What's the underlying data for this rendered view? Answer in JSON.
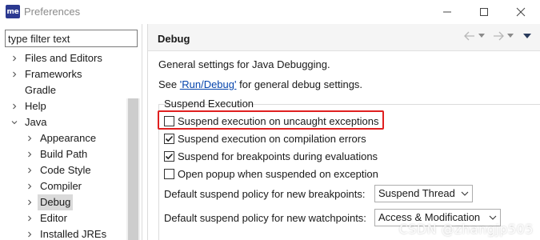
{
  "window": {
    "app_icon_text": "me",
    "title": "Preferences"
  },
  "sidebar": {
    "filter_placeholder": "type filter text",
    "items": [
      {
        "label": "Files and Editors",
        "level": 1,
        "expander": "collapsed"
      },
      {
        "label": "Frameworks",
        "level": 1,
        "expander": "collapsed"
      },
      {
        "label": "Gradle",
        "level": 1,
        "expander": "none"
      },
      {
        "label": "Help",
        "level": 1,
        "expander": "collapsed"
      },
      {
        "label": "Java",
        "level": 1,
        "expander": "expanded"
      },
      {
        "label": "Appearance",
        "level": 2,
        "expander": "collapsed"
      },
      {
        "label": "Build Path",
        "level": 2,
        "expander": "collapsed"
      },
      {
        "label": "Code Style",
        "level": 2,
        "expander": "collapsed"
      },
      {
        "label": "Compiler",
        "level": 2,
        "expander": "collapsed"
      },
      {
        "label": "Debug",
        "level": 2,
        "expander": "collapsed",
        "selected": true
      },
      {
        "label": "Editor",
        "level": 2,
        "expander": "collapsed"
      },
      {
        "label": "Installed JREs",
        "level": 2,
        "expander": "collapsed"
      }
    ]
  },
  "page": {
    "title": "Debug",
    "nav_icons": [
      "back-arrow-icon",
      "dropdown-icon",
      "forward-arrow-icon",
      "dropdown-icon",
      "view-menu-icon"
    ],
    "description": "General settings for Java Debugging.",
    "see_prefix": "See ",
    "see_link": "'Run/Debug'",
    "see_suffix": " for general debug settings.",
    "group_label": "Suspend Execution",
    "checkboxes": [
      {
        "label": "Suspend execution on uncaught exceptions",
        "checked": false,
        "highlighted": true
      },
      {
        "label": "Suspend execution on compilation errors",
        "checked": true
      },
      {
        "label": "Suspend for breakpoints during evaluations",
        "checked": true
      },
      {
        "label": "Open popup when suspended on exception",
        "checked": false
      }
    ],
    "breakpoint_policy": {
      "label": "Default suspend policy for new breakpoints:",
      "value": "Suspend Thread"
    },
    "watchpoint_policy": {
      "label": "Default suspend policy for new watchpoints:",
      "value": "Access & Modification"
    }
  },
  "watermark": "CSDN @zhangjp505",
  "colors": {
    "highlight_border": "#e02020",
    "link": "#0645ad",
    "selection": "#dadada"
  }
}
